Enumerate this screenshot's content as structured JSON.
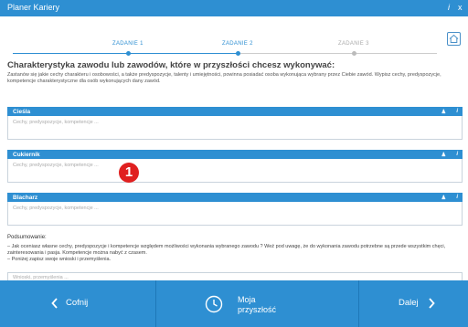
{
  "window": {
    "title": "Planer Kariery",
    "info_icon": "info-icon",
    "close_icon": "close-icon"
  },
  "steps": [
    {
      "label": "ZADANIE 1",
      "state": "done"
    },
    {
      "label": "ZADANIE 2",
      "state": "active"
    },
    {
      "label": "ZADANIE 3",
      "state": "todo"
    }
  ],
  "colors": {
    "accent": "#2e8fd2",
    "step_done": "#2e8fd2",
    "step_todo": "#bbbbbb",
    "badge": "#e02020"
  },
  "page": {
    "heading": "Charakterystyka zawodu lub zawodów, które w przyszłości chcesz wykonywać:",
    "description": "Zastanów się jakie cechy charakteru i osobowości, a także predyspozycje, talenty i umiejętności, powinna posiadać osoba wykonująca wybrany przez Ciebie zawód. Wypisz cechy, predyspozycje, kompetencje charakterystyczne dla osób wykonujących dany zawód."
  },
  "jobs": [
    {
      "name": "Cieśla",
      "placeholder": "Cechy, predyspozycje, kompetencje ..."
    },
    {
      "name": "Cukiernik",
      "placeholder": "Cechy, predyspozycje, kompetencje ..."
    },
    {
      "name": "Blacharz",
      "placeholder": "Cechy, predyspozycje, kompetencje ..."
    }
  ],
  "summary": {
    "title": "Podsumowanie:",
    "line1": "– Jak oceniasz własne cechy, predyspozycje i kompetencje względem możliwości wykonania wybranego zawodu ? Weź pod uwagę, że do wykonania zawodu potrzebne są przede wszystkim chęci, zainteresowania i pasja. Kompetencje można nabyć z czasem.",
    "line2": "– Poniżej zapisz swoje wnioski i przemyślenia.",
    "notes_placeholder": "Wnioski, przemyślenia ..."
  },
  "footer": {
    "back": "Cofnij",
    "future_line1": "Moja",
    "future_line2": "przyszłość",
    "next": "Dalej"
  },
  "annotation": {
    "badge": "1"
  }
}
